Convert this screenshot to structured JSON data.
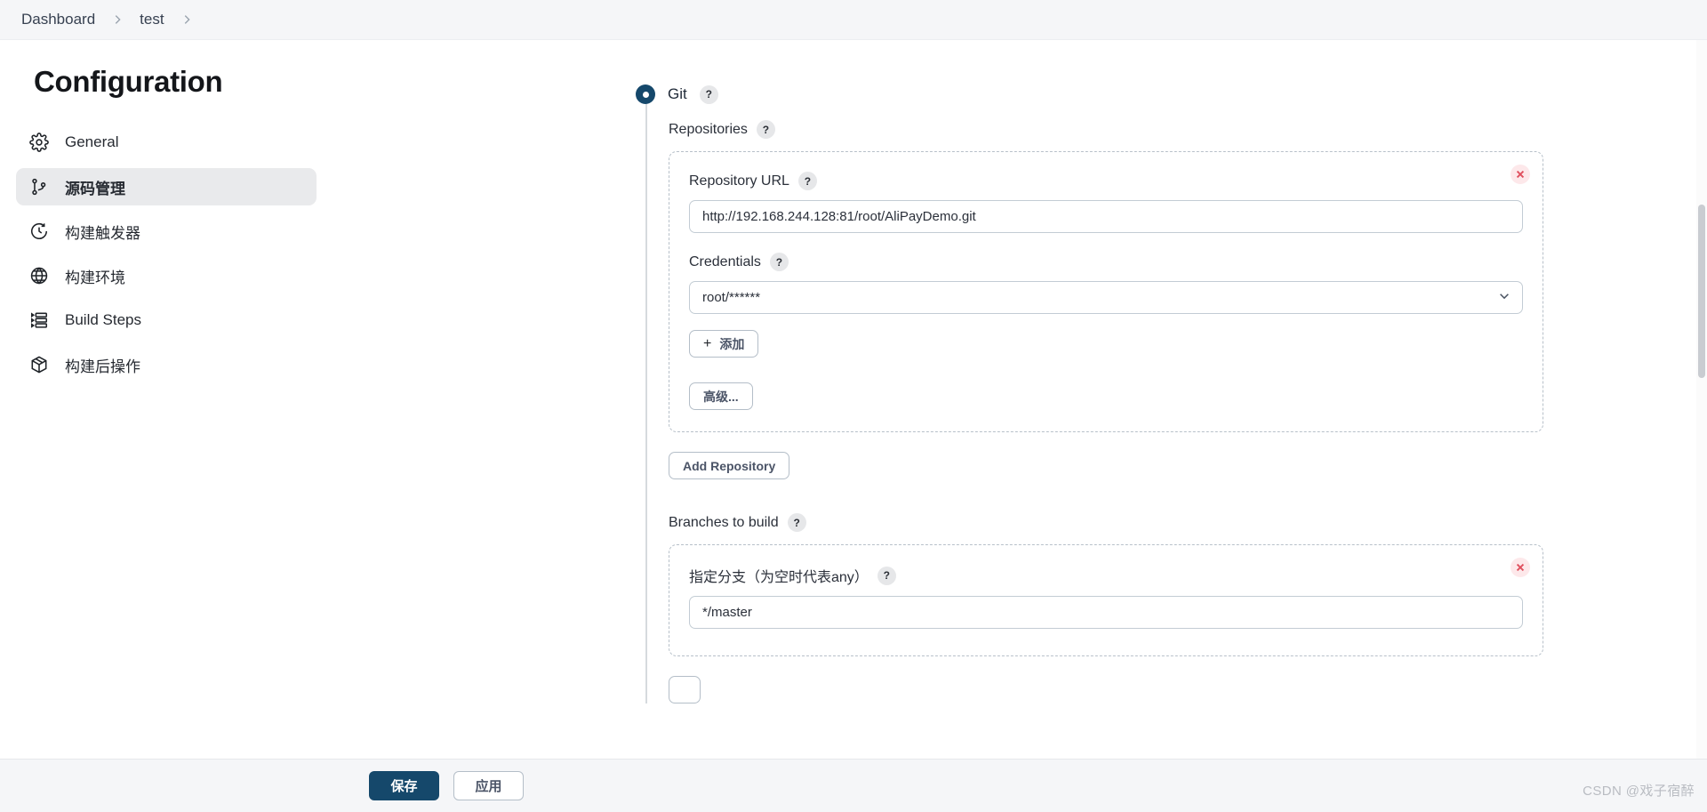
{
  "breadcrumb": {
    "items": [
      {
        "label": "Dashboard"
      },
      {
        "label": "test"
      }
    ]
  },
  "sidebar": {
    "title": "Configuration",
    "items": [
      {
        "label": "General",
        "icon": "gear-icon",
        "active": false
      },
      {
        "label": "源码管理",
        "icon": "git-branch-icon",
        "active": true
      },
      {
        "label": "构建触发器",
        "icon": "clock-icon",
        "active": false
      },
      {
        "label": "构建环境",
        "icon": "globe-icon",
        "active": false
      },
      {
        "label": "Build Steps",
        "icon": "list-steps-icon",
        "active": false
      },
      {
        "label": "构建后操作",
        "icon": "package-icon",
        "active": false
      }
    ]
  },
  "scm": {
    "selected_option": "Git",
    "help_glyph": "?",
    "repositories": {
      "label": "Repositories",
      "repository_url": {
        "label": "Repository URL",
        "value": "http://192.168.244.128:81/root/AliPayDemo.git"
      },
      "credentials": {
        "label": "Credentials",
        "value": "root/******"
      },
      "add_credentials_button": "添加",
      "add_credentials_plus": "+",
      "advanced_button": "高级...",
      "add_repository_button": "Add Repository"
    },
    "branches": {
      "label": "Branches to build",
      "specifier": {
        "label": "指定分支（为空时代表any）",
        "value": "*/master"
      }
    }
  },
  "footer": {
    "save_label": "保存",
    "apply_label": "应用"
  },
  "watermark": "CSDN @戏子宿醉",
  "colors": {
    "accent": "#15486b",
    "sidebar_active_bg": "#e9eaec",
    "close_bg": "#fde8ea",
    "close_stroke": "#e0505e"
  }
}
